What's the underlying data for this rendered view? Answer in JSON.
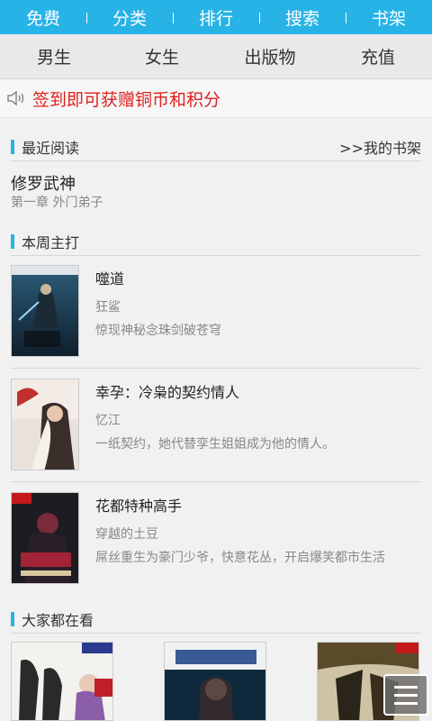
{
  "top_nav": [
    "免费",
    "分类",
    "排行",
    "搜索",
    "书架"
  ],
  "sub_nav": [
    "男生",
    "女生",
    "出版物",
    "充值"
  ],
  "notice": {
    "icon": "speaker-icon",
    "text": "签到即可获赠铜币和积分",
    "color": "#e0201f"
  },
  "recent": {
    "header": "最近阅读",
    "shelf_link": ">>我的书架",
    "book_title": "修罗武神",
    "chapter": "第一章 外门弟子"
  },
  "featured": {
    "header": "本周主打",
    "books": [
      {
        "title": "噬道",
        "author": "狂鲨",
        "desc": "惊现神秘念珠剑破苍穹"
      },
      {
        "title": "幸孕：冷枭的契约情人",
        "author": "忆江",
        "desc": "一纸契约，她代替孪生姐姐成为他的情人。"
      },
      {
        "title": "花都特种高手",
        "author": "穿越的土豆",
        "desc": "屌丝重生为豪门少爷，快意花丛，开启爆笑都市生活"
      }
    ]
  },
  "popular": {
    "header": "大家都在看"
  },
  "colors": {
    "accent": "#27b3e6",
    "notice": "#e0201f",
    "bg": "#f1f1f1"
  }
}
